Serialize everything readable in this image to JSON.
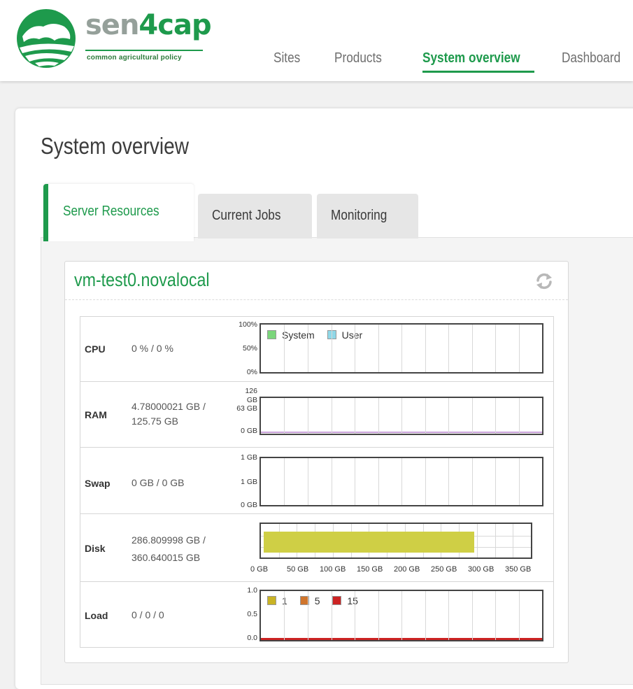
{
  "brand": {
    "name_part1": "sen",
    "name_part2": "4cap",
    "tagline": "common agricultural policy",
    "green": "#1e9a4c"
  },
  "nav": {
    "items": [
      "Sites",
      "Products",
      "System overview",
      "Dashboard"
    ],
    "active": "System overview"
  },
  "page": {
    "title": "System overview"
  },
  "tabs": {
    "items": [
      "Server Resources",
      "Current Jobs",
      "Monitoring"
    ],
    "active": "Server Resources"
  },
  "server": {
    "name": "vm-test0.novalocal",
    "refresh_icon": "refresh-icon",
    "resources": {
      "cpu": {
        "label": "CPU",
        "value": "0 % / 0 %",
        "axis": [
          "100%",
          "50%",
          "0%"
        ],
        "legend": [
          "System",
          "User"
        ]
      },
      "ram": {
        "label": "RAM",
        "value_line1": "4.78000021 GB /",
        "value_line2": "125.75 GB",
        "axis_top1": "126",
        "axis_top2": "GB",
        "axis_mid": "63 GB",
        "axis_bottom": "0 GB"
      },
      "swap": {
        "label": "Swap",
        "value": "0 GB / 0 GB",
        "axis": [
          "1 GB",
          "1 GB",
          "0 GB"
        ]
      },
      "disk": {
        "label": "Disk",
        "value_line1": "286.809998 GB /",
        "value_line2": "360.640015 GB",
        "x_ticks": [
          "0 GB",
          "50 GB",
          "100 GB",
          "150 GB",
          "200 GB",
          "250 GB",
          "300 GB",
          "350 GB"
        ],
        "used_gb": 286.81,
        "total_gb": 360.64,
        "color": "#cfcf45"
      },
      "load": {
        "label": "Load",
        "value": "0 / 0 / 0",
        "axis": [
          "1.0",
          "0.5",
          "0.0"
        ],
        "legend": [
          "1",
          "5",
          "15"
        ]
      }
    }
  },
  "colors": {
    "cpu_system": "#7bd67b",
    "cpu_user": "#8fd8e8",
    "load_1": "#c9b325",
    "load_5": "#d0752c",
    "load_15": "#cc2222",
    "ram_line": "#c8a0d8"
  }
}
